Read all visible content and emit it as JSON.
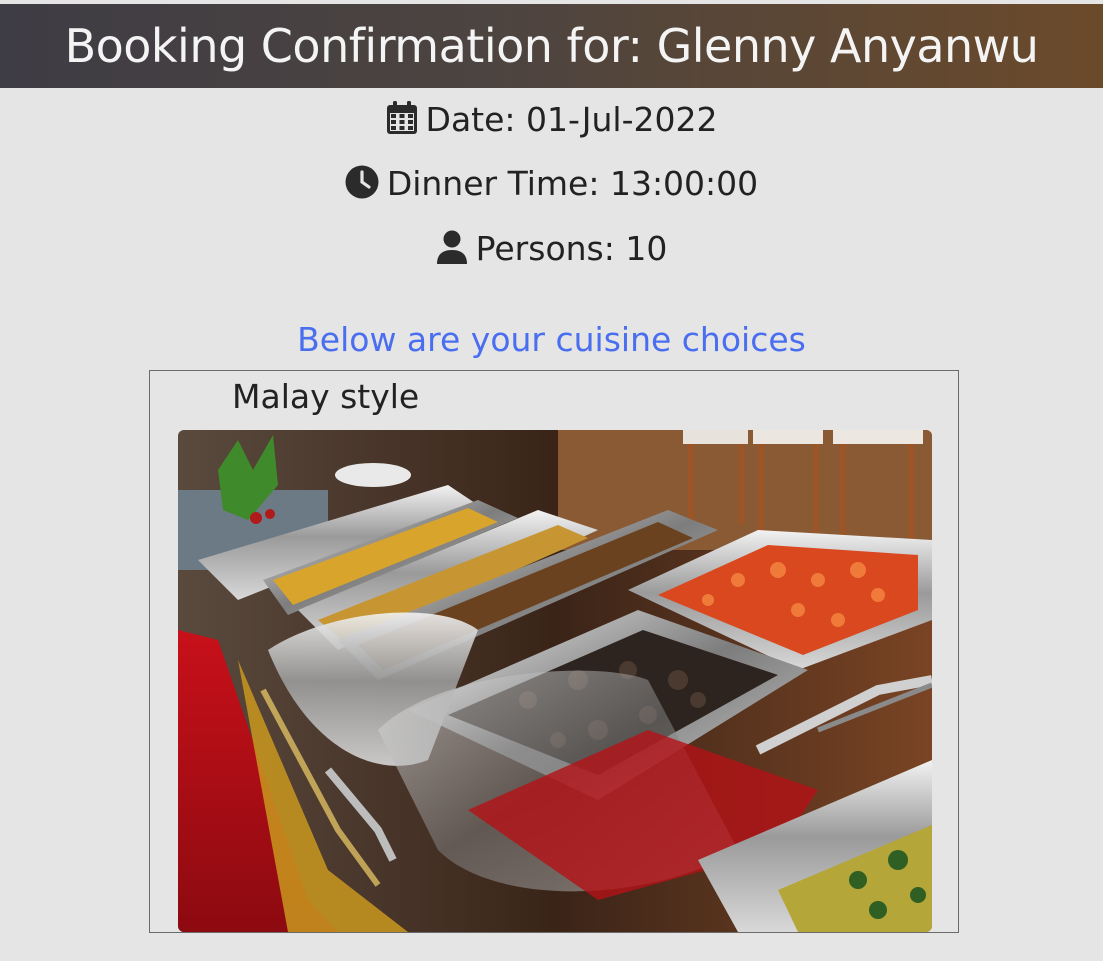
{
  "header": {
    "title": "Booking Confirmation for: Glenny Anyanwu"
  },
  "booking": {
    "date_text": "Date: 01-Jul-2022",
    "time_text": "Dinner Time: 13:00:00",
    "persons_text": "Persons: 10"
  },
  "icons": {
    "date": "calendar-icon",
    "time": "clock-icon",
    "persons": "user-icon"
  },
  "cuisine": {
    "heading": "Below are your cuisine choices",
    "items": [
      {
        "name": "Malay style",
        "image": "buffet-food-photo"
      }
    ]
  },
  "colors": {
    "heading_link": "#4a6ef0",
    "header_gradient_start": "#3e3c44",
    "header_gradient_end": "#6b4a2a",
    "page_background": "#e5e5e5"
  }
}
